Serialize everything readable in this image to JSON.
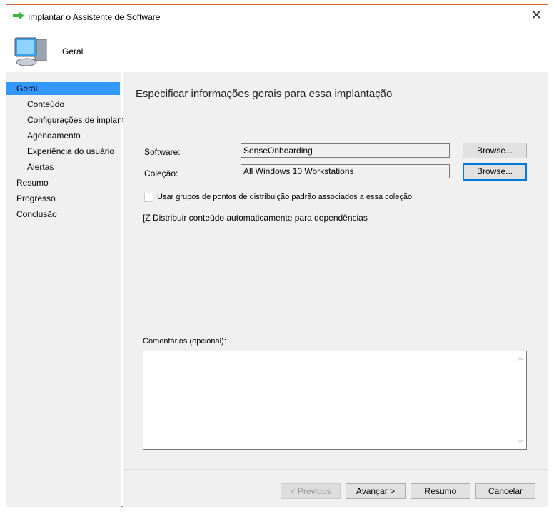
{
  "window": {
    "title": "Implantar o Assistente de Software",
    "header": "Geral"
  },
  "sidebar": {
    "items": [
      {
        "label": "Geral",
        "selected": true,
        "indent": 0
      },
      {
        "label": "Conteúdo",
        "indent": 1
      },
      {
        "label": "Configurações de implantação",
        "indent": 1
      },
      {
        "label": "Agendamento",
        "indent": 1
      },
      {
        "label": "Experiência do usuário",
        "indent": 1
      },
      {
        "label": "Alertas",
        "indent": 1
      },
      {
        "label": "Resumo",
        "indent": 0
      },
      {
        "label": "Progresso",
        "indent": 0
      },
      {
        "label": "Conclusão",
        "indent": 0
      }
    ]
  },
  "main": {
    "heading": "Especificar informações gerais para essa implantação",
    "software_label": "Software:",
    "software_value": "SenseOnboarding",
    "collection_label": "Coleção:",
    "collection_value": "All Windows 10 Workstations",
    "browse": "Browse...",
    "checkbox_label": "Usar grupos de pontos de distribuição padrão associados a essa coleção",
    "auto_distribute": "[Z Distribuir conteúdo automaticamente para dependências",
    "comments_label": "Comentários (opcional):"
  },
  "footer": {
    "previous": "< Previous",
    "next": "Avançar >",
    "summary": "Resumo",
    "cancel": "Cancelar"
  },
  "colors": {
    "selection": "#3399ff",
    "border": "#d4683f",
    "focus": "#0078d7"
  }
}
